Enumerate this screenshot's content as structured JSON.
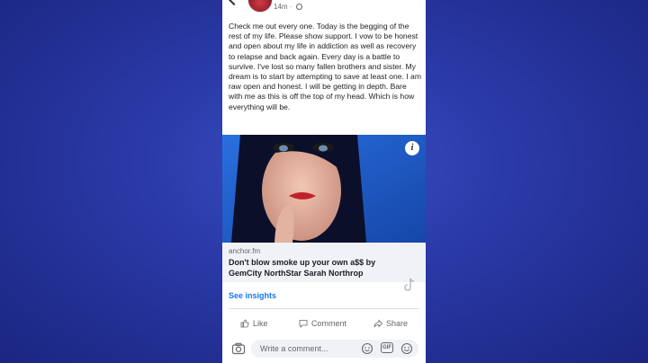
{
  "post": {
    "time": "14m",
    "privacy_icon": "globe-icon",
    "text": "Check me out every one. Today is the begging of the rest of my life. Please show support. I vow to be honest and open about my life in addiction as well as recovery to relapse and back again. Every day is a battle to survive. I've lost so many fallen brothers and sister. My dream is to start by attempting to save at least one. I am raw open and honest. I will be getting in depth. Bare with me as this is off the top of my head. Which is how everything will be."
  },
  "link_preview": {
    "domain": "anchor.fm",
    "title": "Don't blow smoke up your own a$$ by GemCity NorthStar Sarah Northrop"
  },
  "insights_label": "See insights",
  "actions": {
    "like": "Like",
    "comment": "Comment",
    "share": "Share"
  },
  "comment_bar": {
    "placeholder": "Write a comment..."
  },
  "colors": {
    "background": "#2a3aa8",
    "accent": "#1877f2"
  }
}
